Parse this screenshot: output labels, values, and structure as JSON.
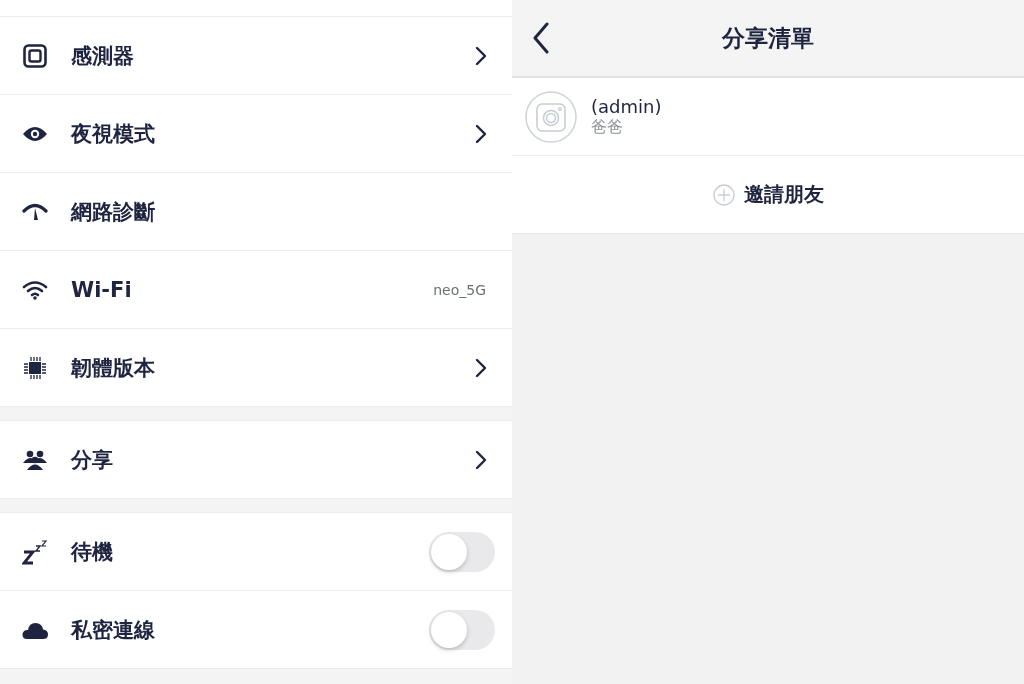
{
  "settings": {
    "groups": [
      {
        "items": [
          {
            "label": "感測器",
            "kind": "link"
          },
          {
            "label": "夜視模式",
            "kind": "link"
          },
          {
            "label": "網路診斷",
            "kind": "plain"
          },
          {
            "label": "Wi-Fi",
            "kind": "value",
            "value": "neo_5G"
          },
          {
            "label": "韌體版本",
            "kind": "link"
          }
        ]
      },
      {
        "items": [
          {
            "label": "分享",
            "kind": "link"
          }
        ]
      },
      {
        "items": [
          {
            "label": "待機",
            "kind": "toggle",
            "on": false
          },
          {
            "label": "私密連線",
            "kind": "toggle",
            "on": false
          }
        ]
      }
    ]
  },
  "share_list": {
    "title": "分享清單",
    "members": [
      {
        "name": "(admin)",
        "nickname": "爸爸"
      }
    ],
    "invite_button": "邀請朋友"
  }
}
